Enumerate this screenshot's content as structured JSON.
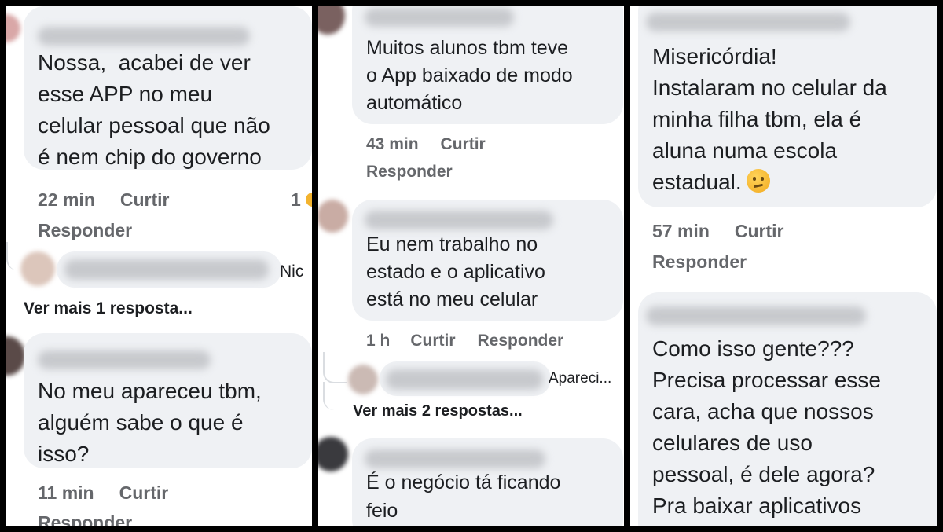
{
  "panels": [
    {
      "comments": [
        {
          "text_lines": [
            "Nossa,  acabei de ver",
            "esse APP no meu",
            "celular pessoal que não",
            "é nem chip do governo"
          ],
          "time": "22 min",
          "like": "Curtir",
          "reply": "Responder",
          "reactions": "1"
        },
        {
          "reply_preview": "Nic",
          "see_more": "Ver mais 1 resposta..."
        },
        {
          "text_lines": [
            "No meu apareceu tbm,",
            "alguém sabe o que é",
            "isso?"
          ],
          "time": "11 min",
          "like": "Curtir",
          "reply": "Responder"
        }
      ]
    },
    {
      "comments": [
        {
          "text_lines": [
            "Muitos alunos tbm teve",
            "o App baixado de modo",
            "automático"
          ],
          "time": "43 min",
          "like": "Curtir",
          "reply": "Responder"
        },
        {
          "text_lines": [
            "Eu nem trabalho no",
            "estado e o aplicativo",
            "está no meu celular"
          ],
          "time": "1 h",
          "like": "Curtir",
          "reply": "Responder"
        },
        {
          "reply_preview": "Apareci...",
          "see_more": "Ver mais 2 respostas..."
        },
        {
          "text_lines": [
            "É o negócio tá ficando",
            "feio"
          ]
        }
      ]
    },
    {
      "comments": [
        {
          "text_lines": [
            "Misericórdia!",
            "Instalaram no celular da",
            "minha filha tbm, ela é",
            "aluna numa escola",
            "estadual."
          ],
          "emoji": "thinking-face",
          "time": "57 min",
          "like": "Curtir",
          "reply": "Responder"
        },
        {
          "text_lines": [
            "Como isso gente???",
            "Precisa processar esse",
            "cara, acha que nossos",
            "celulares de uso",
            "pessoal, é dele agora?",
            "Pra baixar aplicativos"
          ]
        }
      ]
    }
  ]
}
